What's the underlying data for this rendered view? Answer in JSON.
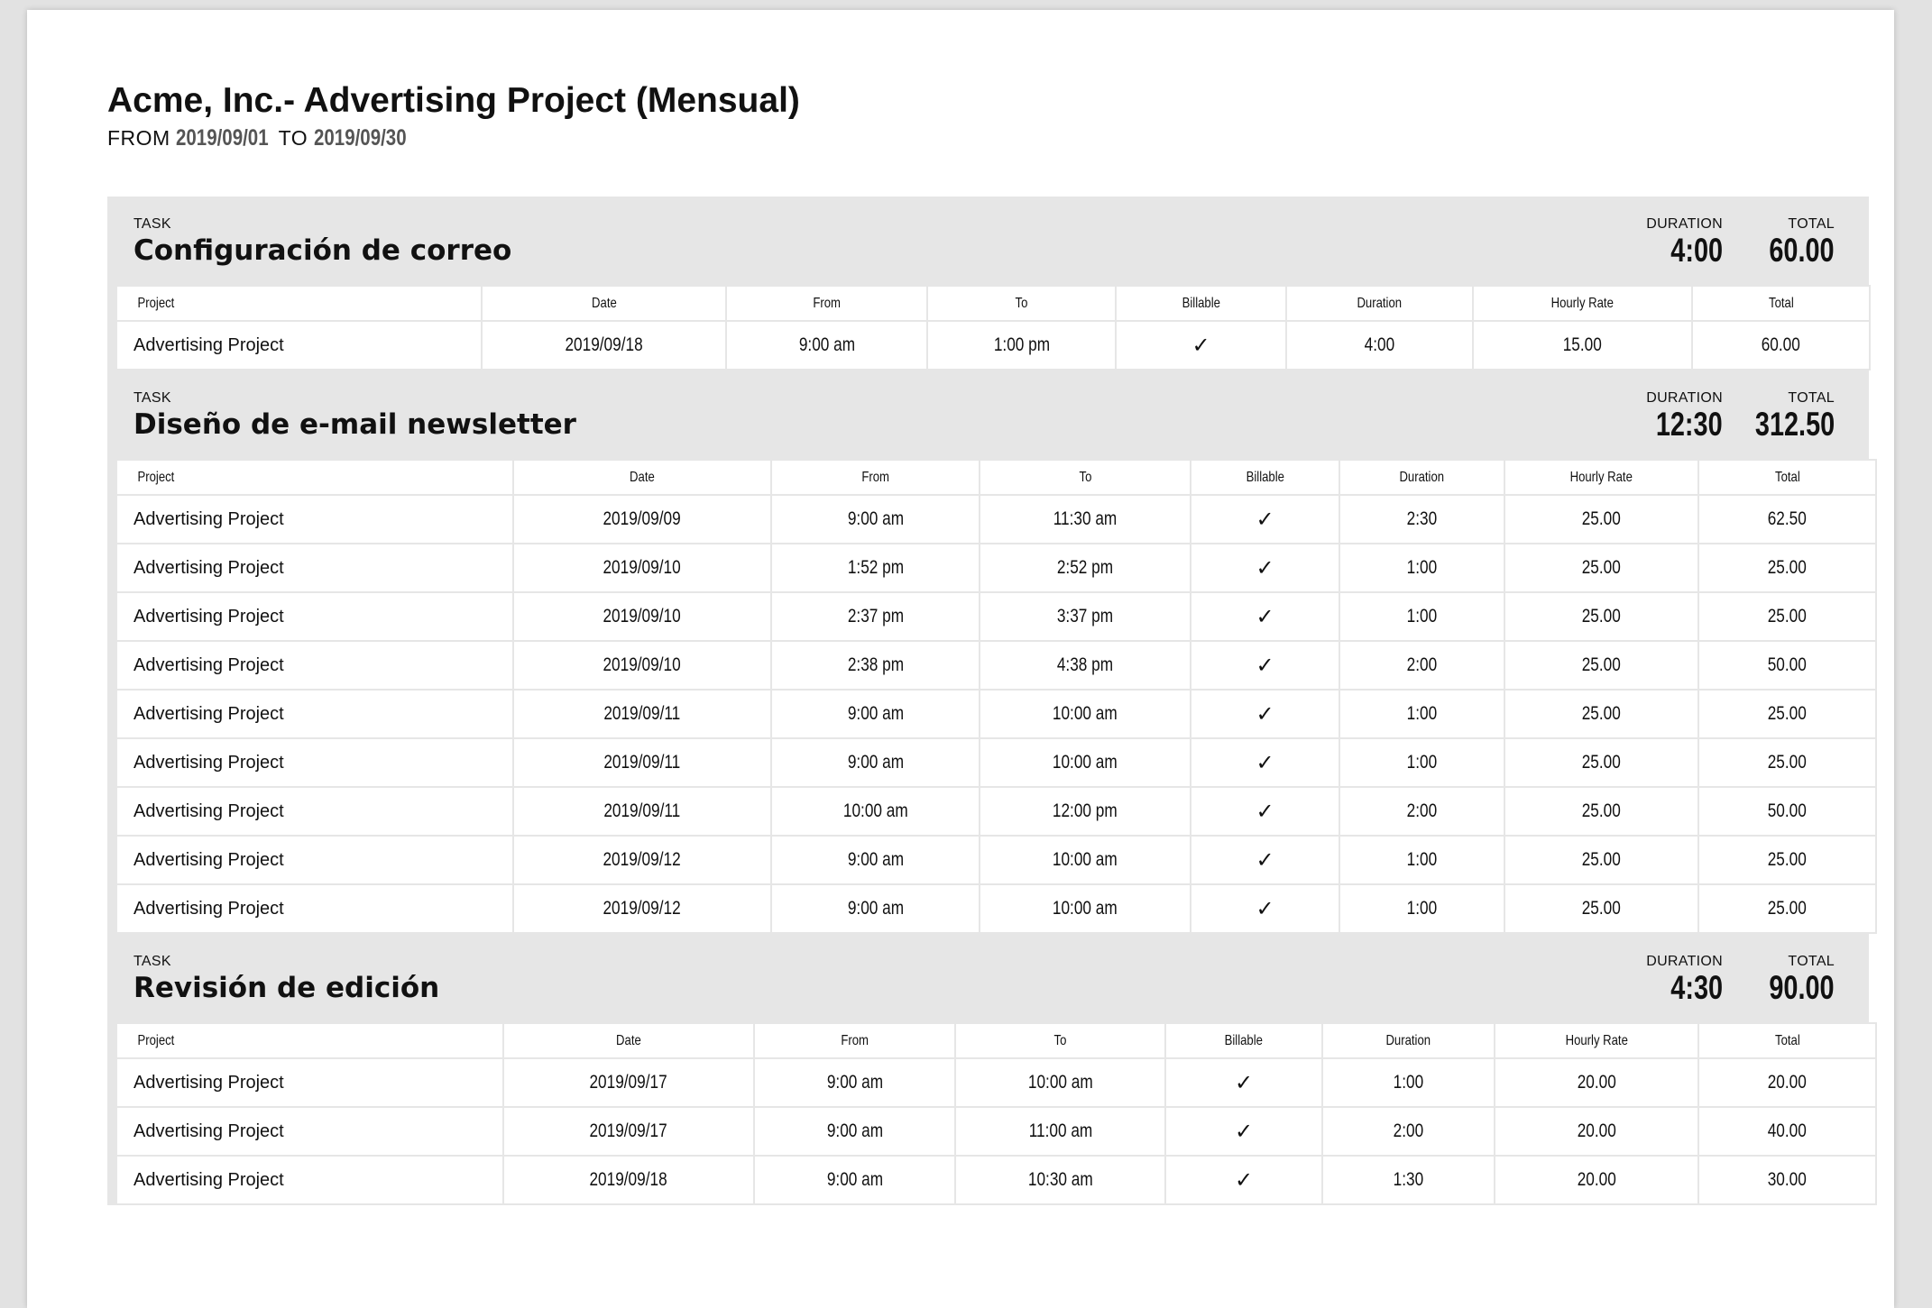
{
  "report": {
    "title": "Acme, Inc.- Advertising Project (Mensual)",
    "from_word": "FROM",
    "from_date": "2019/09/01",
    "to_word": "TO",
    "to_date": "2019/09/30"
  },
  "labels": {
    "task": "TASK",
    "duration": "DURATION",
    "total": "TOTAL",
    "columns": [
      "Project",
      "Date",
      "From",
      "To",
      "Billable",
      "Duration",
      "Hourly Rate",
      "Total"
    ]
  },
  "tasks": [
    {
      "name": "Configuración de correo",
      "duration": "4:00",
      "total": "60.00",
      "rows": [
        [
          "Advertising Project",
          "2019/09/18",
          "9:00 am",
          "1:00 pm",
          "✓",
          "4:00",
          "15.00",
          "60.00"
        ]
      ]
    },
    {
      "name": "Diseño de e-mail newsletter",
      "duration": "12:30",
      "total": "312.50",
      "rows": [
        [
          "Advertising Project",
          "2019/09/09",
          "9:00 am",
          "11:30 am",
          "✓",
          "2:30",
          "25.00",
          "62.50"
        ],
        [
          "Advertising Project",
          "2019/09/10",
          "1:52 pm",
          "2:52 pm",
          "✓",
          "1:00",
          "25.00",
          "25.00"
        ],
        [
          "Advertising Project",
          "2019/09/10",
          "2:37 pm",
          "3:37 pm",
          "✓",
          "1:00",
          "25.00",
          "25.00"
        ],
        [
          "Advertising Project",
          "2019/09/10",
          "2:38 pm",
          "4:38 pm",
          "✓",
          "2:00",
          "25.00",
          "50.00"
        ],
        [
          "Advertising Project",
          "2019/09/11",
          "9:00 am",
          "10:00 am",
          "✓",
          "1:00",
          "25.00",
          "25.00"
        ],
        [
          "Advertising Project",
          "2019/09/11",
          "9:00 am",
          "10:00 am",
          "✓",
          "1:00",
          "25.00",
          "25.00"
        ],
        [
          "Advertising Project",
          "2019/09/11",
          "10:00 am",
          "12:00 pm",
          "✓",
          "2:00",
          "25.00",
          "50.00"
        ],
        [
          "Advertising Project",
          "2019/09/12",
          "9:00 am",
          "10:00 am",
          "✓",
          "1:00",
          "25.00",
          "25.00"
        ],
        [
          "Advertising Project",
          "2019/09/12",
          "9:00 am",
          "10:00 am",
          "✓",
          "1:00",
          "25.00",
          "25.00"
        ]
      ]
    },
    {
      "name": "Revisión de edición",
      "duration": "4:30",
      "total": "90.00",
      "rows": [
        [
          "Advertising Project",
          "2019/09/17",
          "9:00 am",
          "10:00 am",
          "✓",
          "1:00",
          "20.00",
          "20.00"
        ],
        [
          "Advertising Project",
          "2019/09/17",
          "9:00 am",
          "11:00 am",
          "✓",
          "2:00",
          "20.00",
          "40.00"
        ],
        [
          "Advertising Project",
          "2019/09/18",
          "9:00 am",
          "10:30 am",
          "✓",
          "1:30",
          "20.00",
          "30.00"
        ]
      ]
    }
  ]
}
